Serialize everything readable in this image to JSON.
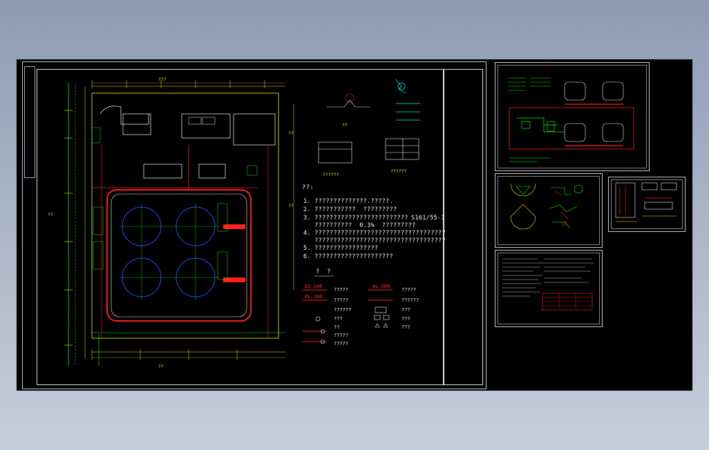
{
  "drawing": {
    "top_label": "???",
    "bottom_label": "??",
    "left_label": "??",
    "right_label_1": "??",
    "right_label_2": "??"
  },
  "notes": {
    "heading": "??:",
    "lines": [
      "1. ??????????????.?????.",
      "2. ???????????  ?????????",
      "3. ?????????????????????????",
      "   ??????????  0.3%  ?????????",
      "4. ???????????????????????????????????",
      "   ???????????????????????????????????",
      "5. ?????????????????",
      "6. ?????????????????????"
    ],
    "code": "S161/55-1"
  },
  "legend": {
    "heading": "?  ?",
    "rows": [
      {
        "left": "?????",
        "right": "?????"
      },
      {
        "left": "?????",
        "right": "??????"
      },
      {
        "left": "??????",
        "right": "???"
      },
      {
        "left": "???",
        "right": "???"
      },
      {
        "left": "??",
        "right": "???"
      },
      {
        "left": "?????",
        "right": ""
      },
      {
        "left": "?????",
        "right": ""
      }
    ],
    "tags": [
      "GS-100",
      "PL-100",
      "AL-200"
    ]
  },
  "details": {
    "detail_a": "??",
    "table_a": "??????",
    "table_b": "??????"
  },
  "colors": {
    "canvas": "#000000",
    "pipe_red": "#ff2020",
    "pipe_green": "#00ff00",
    "tank_blue": "#2a4dff",
    "dim_yellow": "#ffff00",
    "cyan": "#00ffff"
  }
}
